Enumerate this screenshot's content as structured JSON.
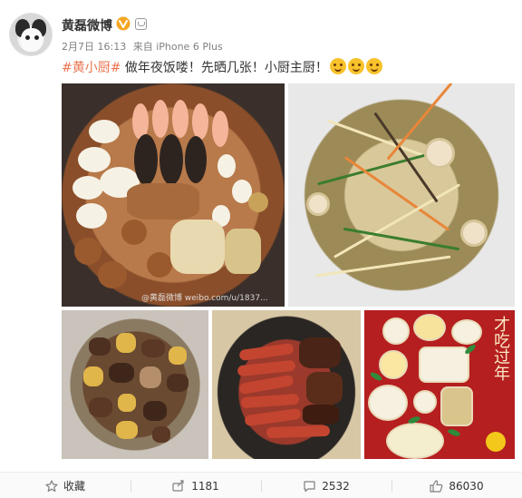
{
  "post": {
    "author": "黄磊微博",
    "time": "2月7日 16:13",
    "source": "来自 iPhone 6 Plus",
    "hashtag": "#黄小厨#",
    "text": " 做年夜饭喽！先晒几张！小厨主厨！",
    "emoji_count": 3,
    "watermark": "@黄磊微博 weibo.com/u/1837..."
  },
  "photos": {
    "poster_chars": "才吃过年"
  },
  "actions": {
    "favorite_label": "收藏",
    "repost_count": "1181",
    "comment_count": "2532",
    "like_count": "86030"
  },
  "colors": {
    "hashtag": "#eb7350",
    "verified_badge": "#f5a623",
    "text": "#333333",
    "meta": "#808080"
  },
  "icons": [
    "verified-badge-icon",
    "member-icon",
    "star-icon",
    "repost-icon",
    "comment-icon",
    "like-icon"
  ]
}
